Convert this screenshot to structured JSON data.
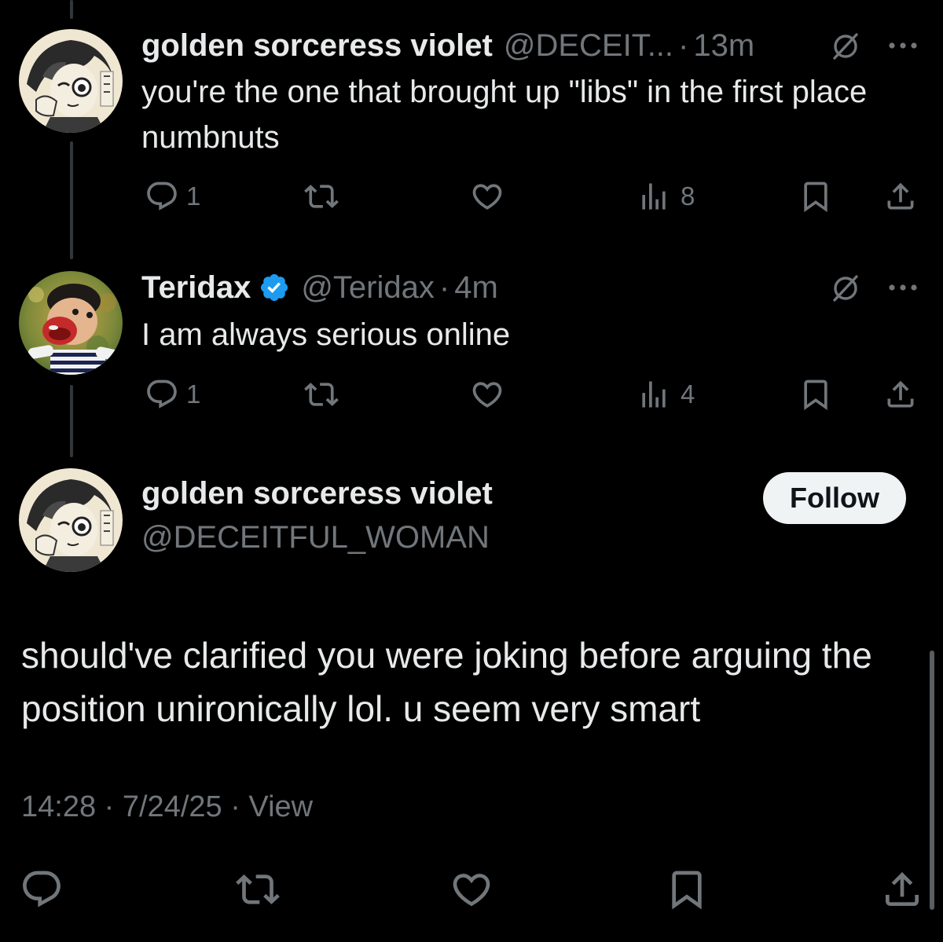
{
  "replies": [
    {
      "name": "golden sorceress violet",
      "handle": "@DECEIT...",
      "separator": "·",
      "time": "13m",
      "text": "you're the one that brought up \"libs\" in the first place numbnuts",
      "reply_count": "1",
      "view_count": "8"
    },
    {
      "name": "Teridax",
      "handle": "@Teridax",
      "separator": "·",
      "time": "4m",
      "text": "I am always serious online",
      "reply_count": "1",
      "view_count": "4"
    }
  ],
  "main_tweet": {
    "name": "golden sorceress violet",
    "handle": "@DECEITFUL_WOMAN",
    "follow_label": "Follow",
    "text": "should've clarified you were joking before arguing the position unironically lol. u seem very smart",
    "meta": "14:28 · 7/24/25 · View"
  },
  "icons": {
    "reply": "reply-icon",
    "retweet": "retweet-icon",
    "like": "like-icon",
    "views": "views-icon",
    "bookmark": "bookmark-icon",
    "share": "share-icon",
    "muted": "muted-icon",
    "more": "more-icon",
    "verified": "verified-badge-icon"
  },
  "colors": {
    "background": "#000000",
    "primary_text": "#e7e9ea",
    "secondary_text": "#71767b",
    "verified_blue": "#1d9bf0",
    "follow_button_bg": "#eff3f4"
  }
}
